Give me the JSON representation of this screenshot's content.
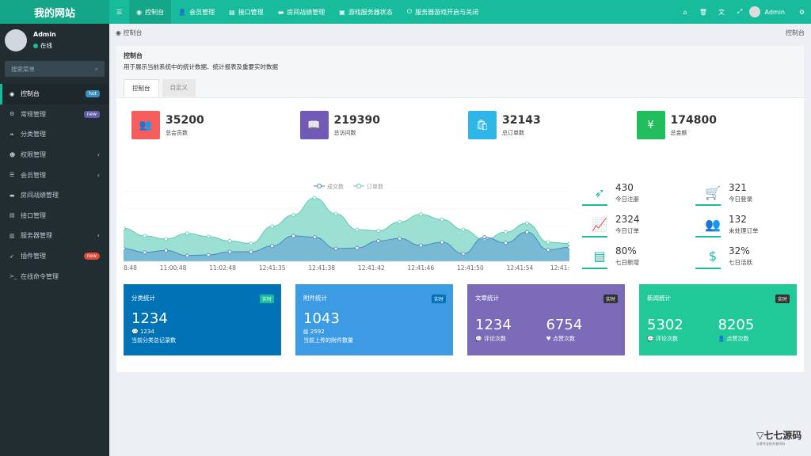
{
  "app": {
    "logo": "我的网站"
  },
  "topnav": {
    "tabs": [
      {
        "label": "控制台",
        "icon": "dashboard-icon"
      },
      {
        "label": "会员管理",
        "icon": "user-icon"
      },
      {
        "label": "接口管理",
        "icon": "list-icon"
      },
      {
        "label": "房间战绩管理",
        "icon": "card-icon"
      },
      {
        "label": "游戏服务器状态",
        "icon": "image-icon"
      },
      {
        "label": "服务器游戏开启与关闭",
        "icon": "power-icon"
      }
    ],
    "user_name": "Admin"
  },
  "sidebar": {
    "user_name": "Admin",
    "status": "在线",
    "search_placeholder": "搜索菜单",
    "items": [
      {
        "label": "控制台",
        "badge": "hot"
      },
      {
        "label": "常规管理",
        "badge": "new"
      },
      {
        "label": "分类管理"
      },
      {
        "label": "权限管理"
      },
      {
        "label": "会员管理"
      },
      {
        "label": "房间战绩管理"
      },
      {
        "label": "接口管理"
      },
      {
        "label": "服务器管理"
      },
      {
        "label": "插件管理",
        "badge": "new"
      },
      {
        "label": "在线命令管理"
      }
    ]
  },
  "breadcrumb": {
    "left": "控制台",
    "right": "控制台"
  },
  "panel": {
    "title": "控制台",
    "desc": "用于展示当前系统中的统计数据、统计报表及重要实时数据",
    "tabs": [
      "控制台",
      "自定义"
    ]
  },
  "stats": [
    {
      "value": "35200",
      "label": "总会员数",
      "color": "#f75d5c"
    },
    {
      "value": "219390",
      "label": "总访问数",
      "color": "#6f5ab8"
    },
    {
      "value": "32143",
      "label": "总订单数",
      "color": "#2fb6e8"
    },
    {
      "value": "174800",
      "label": "总金额",
      "color": "#22bd5d"
    }
  ],
  "mini": [
    {
      "value": "430",
      "label": "今日注册"
    },
    {
      "value": "321",
      "label": "今日登录"
    },
    {
      "value": "2324",
      "label": "今日订单"
    },
    {
      "value": "132",
      "label": "未处理订单"
    },
    {
      "value": "80%",
      "label": "七日新增"
    },
    {
      "value": "32%",
      "label": "七日活跃"
    }
  ],
  "cards": [
    {
      "title": "分类统计",
      "tag": "实时",
      "big": "1234",
      "sub": "1234",
      "desc": "当前分类总记录数"
    },
    {
      "title": "附件统计",
      "tag": "实时",
      "big": "1043",
      "sub": "2592",
      "desc": "当前上传的附件数量"
    },
    {
      "title": "文章统计",
      "tag": "实时",
      "a": "1234",
      "a_label": "评论次数",
      "b": "6754",
      "b_label": "点赞次数"
    },
    {
      "title": "新闻统计",
      "tag": "实时",
      "a": "5302",
      "a_label": "评论次数",
      "b": "8205",
      "b_label": "点赞次数"
    }
  ],
  "chart_data": {
    "type": "area",
    "series": [
      {
        "name": "成交数",
        "values": [
          20,
          14,
          17,
          9,
          10,
          15,
          15,
          24,
          40,
          38,
          20,
          21,
          32,
          36,
          25,
          30,
          12,
          38,
          29,
          46,
          18,
          22
        ]
      },
      {
        "name": "订单数",
        "values": [
          52,
          40,
          35,
          44,
          39,
          32,
          28,
          55,
          73,
          100,
          75,
          50,
          48,
          62,
          74,
          66,
          50,
          34,
          46,
          60,
          30,
          28
        ]
      }
    ],
    "x_tick_labels": [
      "8:48",
      "11:00:48",
      "11:02:48",
      "12:41:35",
      "12:41:38",
      "12:41:42",
      "12:41:46",
      "12:41:50",
      "12:41:54",
      "12:41:"
    ],
    "ylim": [
      0,
      110
    ],
    "grid": true,
    "legend": "top-center"
  },
  "colors": {
    "accent": "#18bc9c",
    "sidebar": "#222d32",
    "series1": "#5b9bd5",
    "series2": "#7ad6c4"
  },
  "brand": {
    "name": "七七源码",
    "tagline": "分享专业的开源代码"
  }
}
